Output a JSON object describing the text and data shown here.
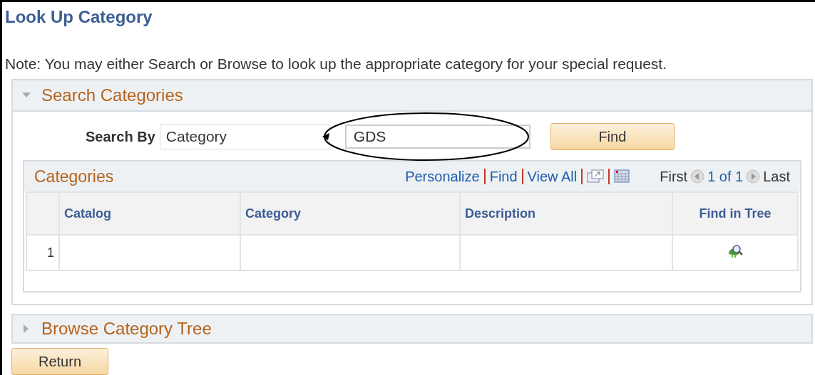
{
  "page_title": "Look Up Category",
  "note": "Note: You may either Search or Browse to look up the appropriate category for your special request.",
  "search_section": {
    "title": "Search Categories",
    "expanded": true,
    "search_by_label": "Search By",
    "search_by_value": "Category",
    "search_value": "GDS",
    "find_button": "Find",
    "grid": {
      "title": "Categories",
      "links": [
        "Personalize",
        "Find",
        "View All"
      ],
      "first": "First",
      "range": "1 of 1",
      "last": "Last",
      "columns": [
        "",
        "Catalog",
        "Category",
        "Description",
        "Find in Tree"
      ],
      "rows": [
        {
          "number": "1",
          "catalog": "",
          "category": "",
          "description": ""
        }
      ]
    }
  },
  "browse_section": {
    "title": "Browse Category Tree",
    "expanded": false
  },
  "return_button": "Return"
}
